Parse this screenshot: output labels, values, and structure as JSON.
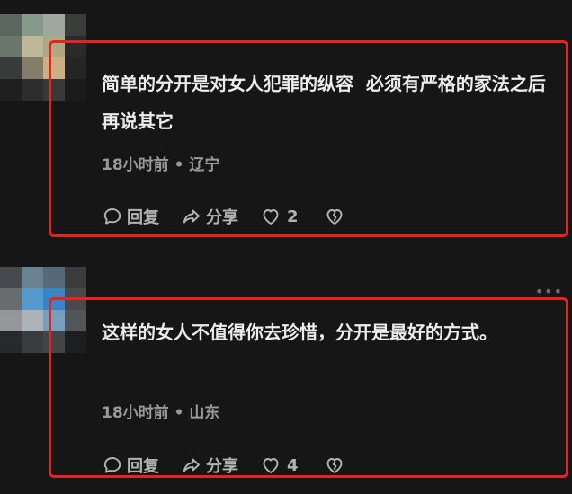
{
  "comments": [
    {
      "text": "简单的分开是对女人犯罪的纵容  必须有严格的家法之后再说其它",
      "time": "18小时前",
      "location": "辽宁",
      "reply_label": "回复",
      "share_label": "分享",
      "like_count": "2",
      "avatar_colors": [
        "#5f6b62",
        "#8da293",
        "#a7b0a4",
        "#3c3f3c",
        "#6f7c71",
        "#c7c1a1",
        "#b9b08b",
        "#2b2c2b",
        "#3a3d3b",
        "#8e826f",
        "#d8b889",
        "#262626",
        "#1f201f",
        "#2e2f2e",
        "#3a3a3a",
        "#1c1c1c"
      ]
    },
    {
      "text": "这样的女人不值得你去珍惜，分开是最好的方式。",
      "time": "18小时前",
      "location": "山东",
      "reply_label": "回复",
      "share_label": "分享",
      "like_count": "4",
      "avatar_colors": [
        "#4a4d50",
        "#6f8799",
        "#5b6d7c",
        "#3b3d3f",
        "#6e7174",
        "#5aa3d8",
        "#3c8ad0",
        "#4a4c4e",
        "#9a9ea2",
        "#b7bcc0",
        "#7da6c6",
        "#575a5c",
        "#2a2b2c",
        "#3d3f41",
        "#454749",
        "#1e1f20"
      ]
    }
  ],
  "colors": {
    "highlight": "#e8231f",
    "background": "#161616"
  },
  "icons": [
    "reply-bubble-icon",
    "share-arrow-icon",
    "heart-icon",
    "broken-heart-icon",
    "more-dots-icon"
  ]
}
